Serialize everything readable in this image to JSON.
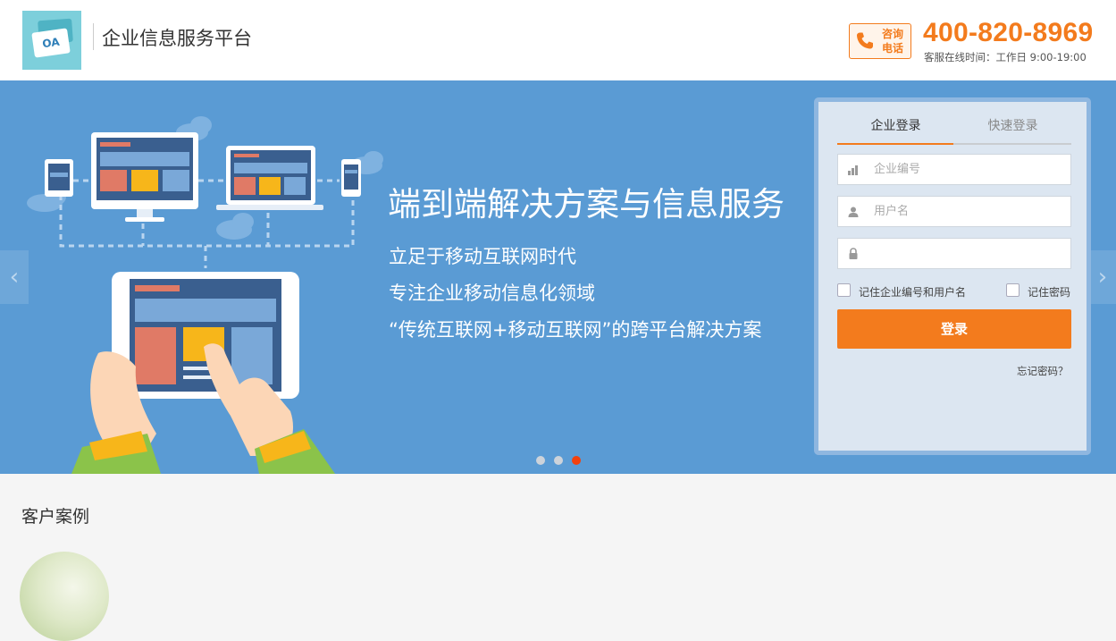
{
  "header": {
    "logo_text": "OA",
    "site_title": "企业信息服务平台",
    "hotline_label_line1": "咨询",
    "hotline_label_line2": "电话",
    "hotline_number": "400-820-8969",
    "service_hours": "客服在线时间：工作日 9:00-19:00"
  },
  "banner": {
    "headline": "端到端解决方案与信息服务",
    "lines": [
      "立足于移动互联网时代",
      "专注企业移动信息化领域",
      "“传统互联网+移动互联网”的跨平台解决方案"
    ],
    "arrow_left": "‹",
    "arrow_right": "›",
    "slide_count": 3,
    "active_slide": 3,
    "colors": {
      "banner_bg": "#5a9bd4",
      "accent": "#f37b1d",
      "active_dot": "#f2410d"
    }
  },
  "login": {
    "tabs": [
      {
        "label": "企业登录",
        "active": true
      },
      {
        "label": "快速登录",
        "active": false
      }
    ],
    "company_placeholder": "企业编号",
    "company_value": "",
    "username_placeholder": "用户名",
    "username_value": "",
    "password_placeholder": "",
    "password_value": "",
    "remember_company_user": "记住企业编号和用户名",
    "remember_password": "记住密码",
    "login_button": "登录",
    "forgot_password": "忘记密码？"
  },
  "cases": {
    "title": "客户案例"
  }
}
